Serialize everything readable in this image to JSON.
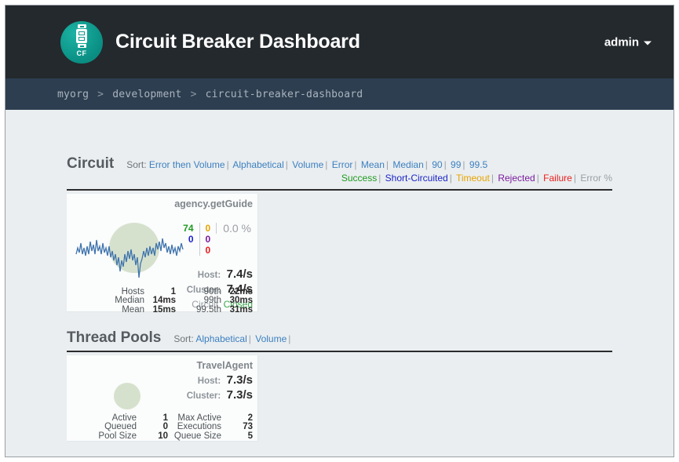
{
  "header": {
    "title": "Circuit Breaker Dashboard",
    "logo_text": "CF",
    "logo_icon": "circuit-breaker-icon",
    "user": "admin",
    "caret_icon": "chevron-down-icon",
    "bg_color": "#24292d",
    "logo_color": "#0d9a8e"
  },
  "breadcrumb": {
    "items": [
      "myorg",
      "development",
      "circuit-breaker-dashboard"
    ],
    "separator": ">",
    "bg_color": "#2d3e50"
  },
  "circuit_section": {
    "title": "Circuit",
    "sort_label": "Sort:",
    "sort_links": [
      "Error then Volume",
      "Alphabetical",
      "Volume",
      "Error",
      "Mean",
      "Median",
      "90",
      "99",
      "99.5"
    ],
    "legend": [
      {
        "label": "Success",
        "color": "#1f9a1f"
      },
      {
        "label": "Short-Circuited",
        "color": "#1b24c8"
      },
      {
        "label": "Timeout",
        "color": "#e8a400"
      },
      {
        "label": "Rejected",
        "color": "#7a1a9e"
      },
      {
        "label": "Failure",
        "color": "#ec1c1c"
      },
      {
        "label": "Error %",
        "color": "#9aa0a5"
      }
    ]
  },
  "circuit_card": {
    "name": "agency.getGuide",
    "counters": {
      "success": "74",
      "short_circuited": "0",
      "timeout": "0",
      "rejected": "0",
      "failure": "0",
      "error_percent": "0.0 %"
    },
    "host_label": "Host:",
    "host_rate": "7.4/s",
    "cluster_label": "Cluster:",
    "cluster_rate": "7.4/s",
    "circuit_label": "Circuit",
    "circuit_state": "Closed",
    "stats_left": [
      {
        "key": "Hosts",
        "value": "1"
      },
      {
        "key": "Median",
        "value": "14ms"
      },
      {
        "key": "Mean",
        "value": "15ms"
      }
    ],
    "stats_right": [
      {
        "key": "90th",
        "value": "22ms"
      },
      {
        "key": "99th",
        "value": "30ms"
      },
      {
        "key": "99.5th",
        "value": "31ms"
      }
    ]
  },
  "thread_section": {
    "title": "Thread Pools",
    "sort_label": "Sort:",
    "sort_links": [
      "Alphabetical",
      "Volume"
    ]
  },
  "thread_card": {
    "name": "TravelAgent",
    "host_label": "Host:",
    "host_rate": "7.3/s",
    "cluster_label": "Cluster:",
    "cluster_rate": "7.3/s",
    "stats_left": [
      {
        "key": "Active",
        "value": "1"
      },
      {
        "key": "Queued",
        "value": "0"
      },
      {
        "key": "Pool Size",
        "value": "10"
      }
    ],
    "stats_right": [
      {
        "key": "Max Active",
        "value": "2"
      },
      {
        "key": "Executions",
        "value": "73"
      },
      {
        "key": "Queue Size",
        "value": "5"
      }
    ]
  }
}
